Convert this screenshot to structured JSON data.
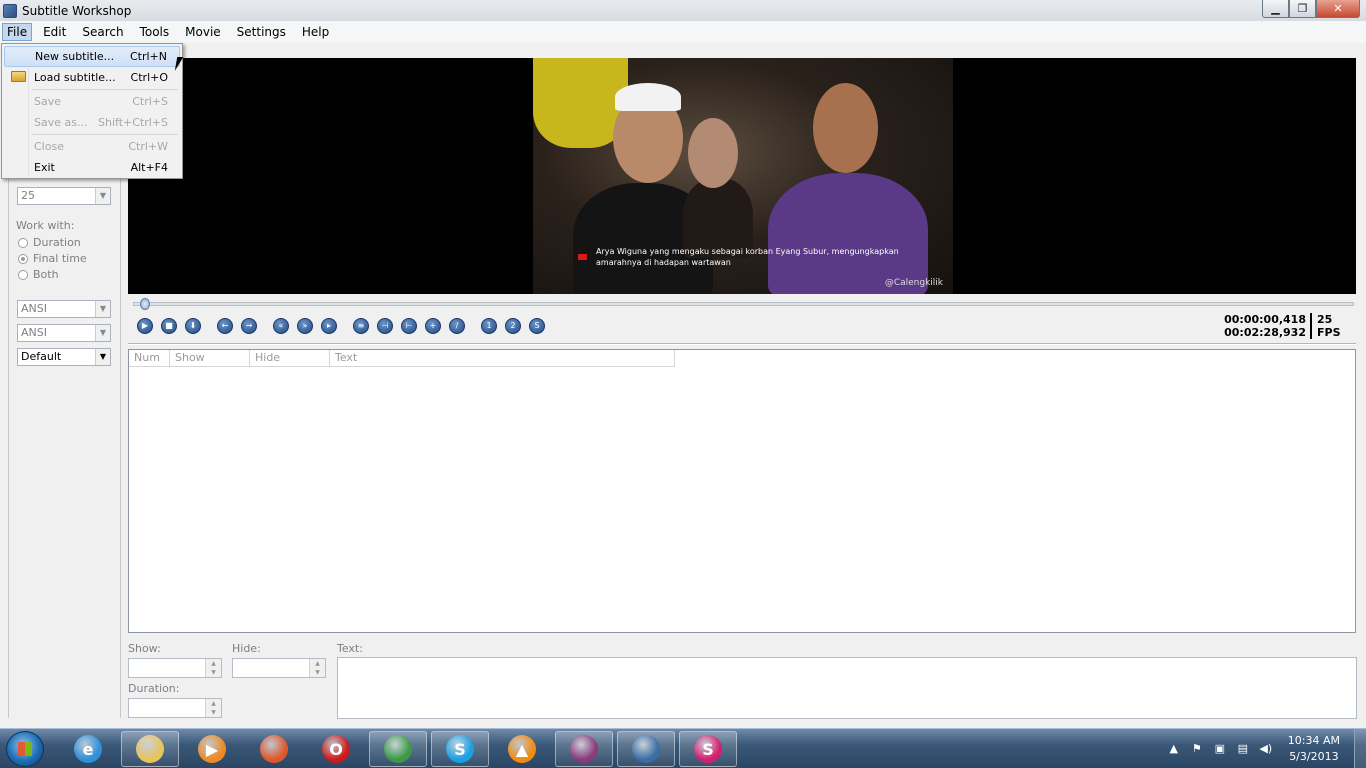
{
  "window": {
    "title": "Subtitle Workshop",
    "minimize": "▁",
    "maximize": "❐",
    "close": "✕"
  },
  "menubar": {
    "items": [
      "File",
      "Edit",
      "Search",
      "Tools",
      "Movie",
      "Settings",
      "Help"
    ]
  },
  "file_menu": {
    "items": [
      {
        "label": "New subtitle...",
        "shortcut": "Ctrl+N",
        "enabled": true
      },
      {
        "label": "Load subtitle...",
        "shortcut": "Ctrl+O",
        "enabled": true
      },
      {
        "label": "Save",
        "shortcut": "Ctrl+S",
        "enabled": false
      },
      {
        "label": "Save as...",
        "shortcut": "Shift+Ctrl+S",
        "enabled": false
      },
      {
        "label": "Close",
        "shortcut": "Ctrl+W",
        "enabled": false
      },
      {
        "label": "Exit",
        "shortcut": "Alt+F4",
        "enabled": true
      }
    ]
  },
  "left_panel": {
    "fps_value": "25",
    "work_with_label": "Work with:",
    "work_with_options": [
      "Duration",
      "Final time",
      "Both"
    ],
    "work_with_selected": "Final time",
    "charset_1": "ANSI",
    "charset_2": "ANSI",
    "style": "Default"
  },
  "video": {
    "subtitle_line1": "Arya Wiguna yang mengaku sebagai korban Eyang Subur, mengungkapkan",
    "subtitle_line2": "amarahnya di hadapan wartawan",
    "watermark": "@Calengkilik",
    "position_fraction": 0.003
  },
  "playback": {
    "current_time": "00:00:00,418",
    "total_time": "00:02:28,932",
    "fps": "25",
    "fps_unit": "FPS",
    "buttons": [
      {
        "name": "play-button",
        "glyph": "▶"
      },
      {
        "name": "stop-button",
        "glyph": "■"
      },
      {
        "name": "pause-button",
        "glyph": "⬇"
      },
      {
        "name": "rewind-button",
        "glyph": "←"
      },
      {
        "name": "forward-button",
        "glyph": "→"
      },
      {
        "name": "back-fast-button",
        "glyph": "«"
      },
      {
        "name": "forward-fast-button",
        "glyph": "»"
      },
      {
        "name": "next-frame-button",
        "glyph": "▸"
      },
      {
        "name": "toggle-subtitles-button",
        "glyph": "≡"
      },
      {
        "name": "set-show-time-button",
        "glyph": "⊣"
      },
      {
        "name": "set-hide-time-button",
        "glyph": "⊢"
      },
      {
        "name": "start-subtitle-button",
        "glyph": "+"
      },
      {
        "name": "end-subtitle-button",
        "glyph": "/"
      },
      {
        "name": "sync-point-1-button",
        "glyph": "1"
      },
      {
        "name": "sync-point-2-button",
        "glyph": "2"
      },
      {
        "name": "sync-button",
        "glyph": "S"
      }
    ]
  },
  "list": {
    "columns": [
      "Num",
      "Show",
      "Hide",
      "Text"
    ]
  },
  "editor": {
    "show_label": "Show:",
    "hide_label": "Hide:",
    "text_label": "Text:",
    "duration_label": "Duration:"
  },
  "taskbar": {
    "apps": [
      {
        "name": "internet-explorer-icon",
        "color": "#2f8fd8",
        "glyph": "e",
        "pinned": false
      },
      {
        "name": "explorer-folder-icon",
        "color": "#e9c45c",
        "glyph": "",
        "pinned": true
      },
      {
        "name": "media-player-icon",
        "color": "#f08a24",
        "glyph": "▶",
        "pinned": false
      },
      {
        "name": "firefox-icon",
        "color": "#e0582a",
        "glyph": "",
        "pinned": false
      },
      {
        "name": "opera-icon",
        "color": "#cc1a1a",
        "glyph": "O",
        "pinned": false
      },
      {
        "name": "chrome-icon",
        "color": "#3b9a44",
        "glyph": "",
        "pinned": true
      },
      {
        "name": "skype-icon",
        "color": "#18a0e4",
        "glyph": "S",
        "pinned": true
      },
      {
        "name": "vlc-icon",
        "color": "#f28a10",
        "glyph": "▲",
        "pinned": false
      },
      {
        "name": "winrar-icon",
        "color": "#8b3a7a",
        "glyph": "",
        "pinned": true
      },
      {
        "name": "subtitle-edit-icon",
        "color": "#3a6ea5",
        "glyph": "",
        "pinned": true
      },
      {
        "name": "subtitle-workshop-icon",
        "color": "#d21f6e",
        "glyph": "S",
        "pinned": true
      }
    ],
    "clock_time": "10:34 AM",
    "clock_date": "5/3/2013"
  }
}
